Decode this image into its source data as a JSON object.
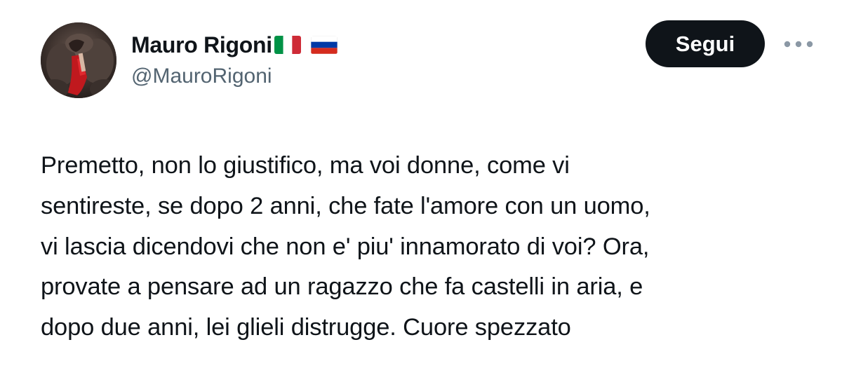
{
  "author": {
    "display_name": "Mauro Rigoni",
    "handle": "@MauroRigoni",
    "flags": [
      "italy-flag-icon",
      "russia-flag-icon"
    ]
  },
  "actions": {
    "follow_label": "Segui",
    "more_icon": "more-horizontal-icon"
  },
  "tweet": {
    "lines": [
      "Premetto, non lo giustifico, ma voi donne, come vi",
      "sentireste, se dopo 2 anni, che fate l'amore con un uomo,",
      "vi lascia dicendovi che non e' piu' innamorato di voi? Ora,",
      "provate a pensare ad un ragazzo che fa castelli in aria, e",
      "dopo due anni, lei glieli distrugge. Cuore spezzato"
    ]
  },
  "colors": {
    "text": "#0f1419",
    "secondary_text": "#536471",
    "button_bg": "#0f1419",
    "button_text": "#ffffff",
    "background": "#ffffff"
  }
}
